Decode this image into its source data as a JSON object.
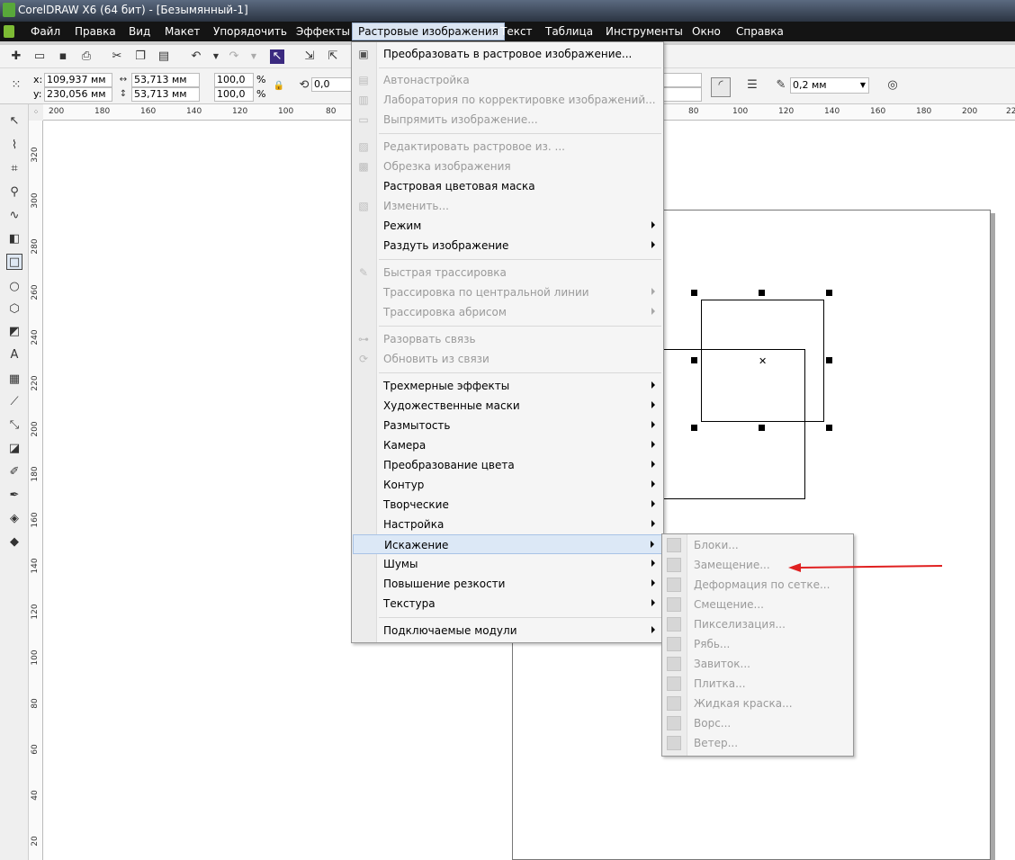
{
  "window": {
    "title": "CorelDRAW X6 (64 бит) - [Безымянный-1]"
  },
  "menubar": [
    {
      "label": "Файл"
    },
    {
      "label": "Правка"
    },
    {
      "label": "Вид"
    },
    {
      "label": "Макет"
    },
    {
      "label": "Упорядочить"
    },
    {
      "label": "Эффекты"
    },
    {
      "label": "Растровые изображения"
    },
    {
      "label": "Текст"
    },
    {
      "label": "Таблица"
    },
    {
      "label": "Инструменты"
    },
    {
      "label": "Окно"
    },
    {
      "label": "Справка"
    }
  ],
  "property_bar": {
    "x_label": "x:",
    "x_value": "109,937 мм",
    "y_label": "y:",
    "y_value": "230,056 мм",
    "width": "53,713 мм",
    "height": "53,713 мм",
    "scale_x": "100,0",
    "scale_y": "100,0",
    "percent": "%",
    "rotation": "0,0",
    "outline_width": "0,2 мм"
  },
  "ruler_h": [
    "200",
    "180",
    "160",
    "140",
    "120",
    "100",
    "80",
    "80",
    "100",
    "120",
    "140",
    "160",
    "180",
    "200",
    "22"
  ],
  "ruler_v": [
    "320",
    "300",
    "280",
    "260",
    "240",
    "220",
    "200",
    "180",
    "160",
    "140",
    "120",
    "100",
    "80",
    "60",
    "40",
    "20"
  ],
  "menu": {
    "items": [
      {
        "label": "Преобразовать в растровое изображение...",
        "disabled": false
      },
      {
        "label": "Автонастройка",
        "disabled": true
      },
      {
        "label": "Лаборатория по корректировке изображений...",
        "disabled": true
      },
      {
        "label": "Выпрямить изображение...",
        "disabled": true
      },
      {
        "label": "Редактировать растровое из. ...",
        "disabled": true
      },
      {
        "label": "Обрезка изображения",
        "disabled": true
      },
      {
        "label": "Растровая цветовая маска",
        "disabled": false
      },
      {
        "label": "Изменить...",
        "disabled": true
      },
      {
        "label": "Режим",
        "disabled": false
      },
      {
        "label": "Раздуть изображение",
        "disabled": false
      },
      {
        "label": "Быстрая трассировка",
        "disabled": true
      },
      {
        "label": "Трассировка по центральной линии",
        "disabled": true
      },
      {
        "label": "Трассировка абрисом",
        "disabled": true
      },
      {
        "label": "Разорвать связь",
        "disabled": true
      },
      {
        "label": "Обновить из связи",
        "disabled": true
      },
      {
        "label": "Трехмерные эффекты",
        "disabled": false
      },
      {
        "label": "Художественные маски",
        "disabled": false
      },
      {
        "label": "Размытость",
        "disabled": false
      },
      {
        "label": "Камера",
        "disabled": false
      },
      {
        "label": "Преобразование цвета",
        "disabled": false
      },
      {
        "label": "Контур",
        "disabled": false
      },
      {
        "label": "Творческие",
        "disabled": false
      },
      {
        "label": "Настройка",
        "disabled": false
      },
      {
        "label": "Искажение",
        "disabled": false
      },
      {
        "label": "Шумы",
        "disabled": false
      },
      {
        "label": "Повышение резкости",
        "disabled": false
      },
      {
        "label": "Текстура",
        "disabled": false
      },
      {
        "label": "Подключаемые модули",
        "disabled": false
      }
    ]
  },
  "submenu": {
    "items": [
      {
        "label": "Блоки..."
      },
      {
        "label": "Замещение..."
      },
      {
        "label": "Деформация по сетке..."
      },
      {
        "label": "Смещение..."
      },
      {
        "label": "Пикселизация..."
      },
      {
        "label": "Рябь..."
      },
      {
        "label": "Завиток..."
      },
      {
        "label": "Плитка..."
      },
      {
        "label": "Жидкая краска..."
      },
      {
        "label": "Ворс..."
      },
      {
        "label": "Ветер..."
      }
    ]
  },
  "annotation": {
    "arrow_color": "#e02020"
  },
  "colors": {
    "menu_highlight": "#dce8f6",
    "titlebar": "#2b3442"
  }
}
